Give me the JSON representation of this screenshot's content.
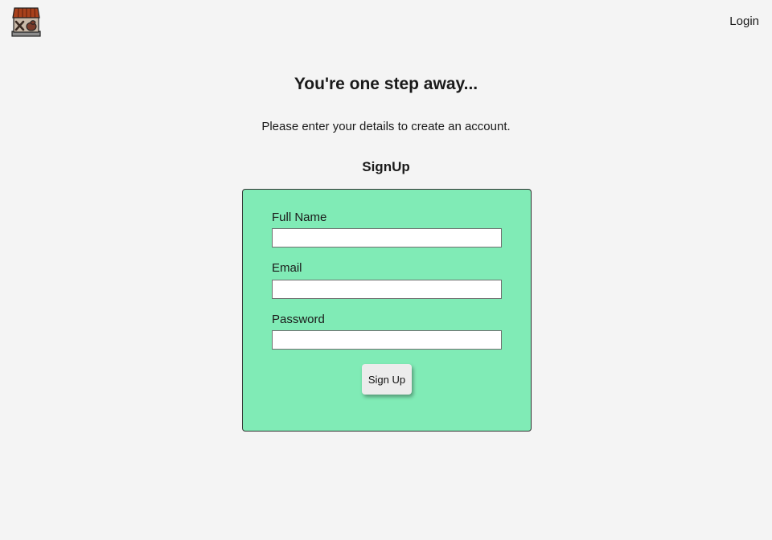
{
  "header": {
    "logo_icon": "storefront-logo-icon",
    "login_label": "Login"
  },
  "main": {
    "headline": "You're one step away...",
    "intro": "Please enter your details to create an account.",
    "form_title": "SignUp"
  },
  "form": {
    "fields": [
      {
        "label": "Full Name",
        "value": ""
      },
      {
        "label": "Email",
        "value": ""
      },
      {
        "label": "Password",
        "value": ""
      }
    ],
    "submit_label": "Sign Up"
  },
  "colors": {
    "page_background": "#f4f4f4",
    "form_background": "#80ebb6",
    "logo_roof": "#a8411c",
    "logo_body": "#c9b9a8",
    "logo_base": "#8c8c8c"
  }
}
